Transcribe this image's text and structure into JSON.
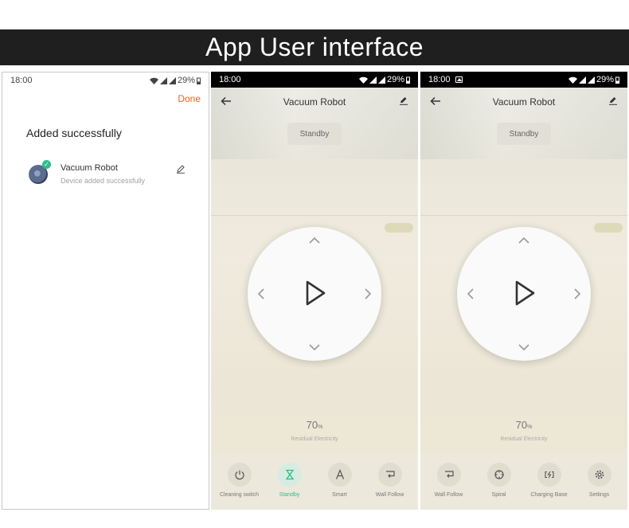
{
  "banner": {
    "title": "App User interface"
  },
  "phone1": {
    "status": {
      "time": "18:00",
      "battery": "29%"
    },
    "done_label": "Done",
    "title": "Added successfully",
    "device": {
      "name": "Vacuum Robot",
      "subtitle": "Device added successfully"
    }
  },
  "phone2": {
    "status": {
      "time": "18:00",
      "battery": "29%"
    },
    "title": "Vacuum Robot",
    "state": "Standby",
    "battery_value": "70",
    "battery_unit": "%",
    "battery_label": "Residual Electricity",
    "bottom": [
      {
        "label": "Cleaning switch",
        "icon": "power-icon"
      },
      {
        "label": "Standby",
        "icon": "hourglass-icon",
        "active": true
      },
      {
        "label": "Smart",
        "icon": "smart-icon"
      },
      {
        "label": "Wall Follow",
        "icon": "wall-follow-icon"
      }
    ]
  },
  "phone3": {
    "status": {
      "time": "18:00",
      "battery": "29%"
    },
    "title": "Vacuum Robot",
    "state": "Standby",
    "battery_value": "70",
    "battery_unit": "%",
    "battery_label": "Residual Electricity",
    "bottom": [
      {
        "label": "Wall Follow",
        "icon": "wall-follow-icon"
      },
      {
        "label": "Spiral",
        "icon": "spiral-icon"
      },
      {
        "label": "Charging Base",
        "icon": "charging-base-icon"
      },
      {
        "label": "Settings",
        "icon": "gear-icon"
      }
    ]
  },
  "colors": {
    "accent": "#f0651f",
    "success": "#2bbf8a",
    "banner_bg": "#1f1f1f"
  }
}
